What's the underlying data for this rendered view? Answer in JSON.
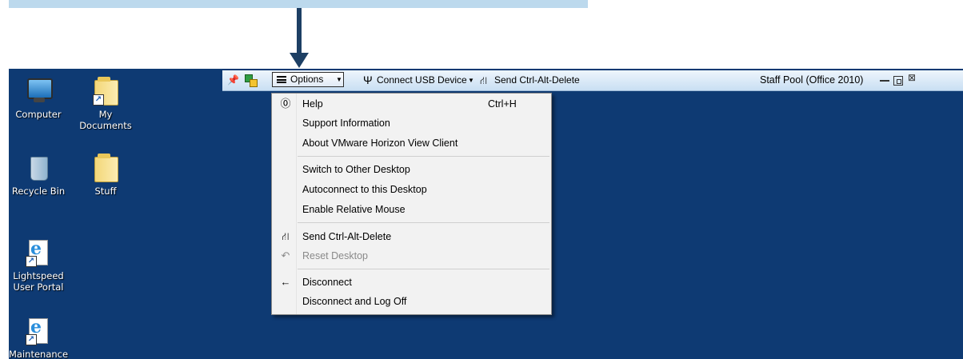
{
  "desktop_icons": [
    {
      "name": "computer",
      "label": "Computer",
      "icon": "computer-icon"
    },
    {
      "name": "my-documents",
      "label": "My Documents",
      "icon": "folder-icon"
    },
    {
      "name": "recycle-bin",
      "label": "Recycle Bin",
      "icon": "recycle-bin-icon"
    },
    {
      "name": "stuff",
      "label": "Stuff",
      "icon": "folder-icon"
    },
    {
      "name": "lightspeed",
      "label": "Lightspeed User Portal",
      "icon": "internet-explorer-icon"
    },
    {
      "name": "maintenance",
      "label": "Maintenance",
      "icon": "internet-explorer-icon"
    }
  ],
  "toolbar": {
    "options_label": "Options",
    "usb_label": "Connect USB Device",
    "cad_label": "Send Ctrl-Alt-Delete",
    "pool_label": "Staff Pool (Office 2010)"
  },
  "menu": {
    "items": [
      {
        "label": "Help",
        "shortcut": "Ctrl+H",
        "icon": "help-icon"
      },
      {
        "label": "Support Information"
      },
      {
        "label": "About VMware Horizon View Client"
      },
      {
        "label": "Switch to Other Desktop"
      },
      {
        "label": "Autoconnect to this Desktop"
      },
      {
        "label": "Enable Relative Mouse"
      },
      {
        "label": "Send Ctrl-Alt-Delete",
        "icon": "network-icon"
      },
      {
        "label": "Reset Desktop",
        "icon": "reset-icon",
        "disabled": true
      },
      {
        "label": "Disconnect",
        "icon": "arrow-left-icon"
      },
      {
        "label": "Disconnect and Log Off"
      }
    ]
  },
  "colors": {
    "desktop_bg": "#0e3a73",
    "callout": "#bcd9ed",
    "arrow": "#1d3f64"
  }
}
